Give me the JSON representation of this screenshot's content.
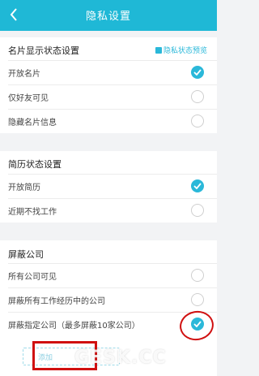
{
  "header": {
    "title": "隐私设置",
    "back_icon": "chevron-left-icon"
  },
  "business_card": {
    "title": "名片显示状态设置",
    "preview_label": "隐私状态预览",
    "options": [
      {
        "label": "开放名片",
        "checked": true
      },
      {
        "label": "仅好友可见",
        "checked": false
      },
      {
        "label": "隐藏名片信息",
        "checked": false
      }
    ]
  },
  "resume": {
    "title": "简历状态设置",
    "options": [
      {
        "label": "开放简历",
        "checked": true
      },
      {
        "label": "近期不找工作",
        "checked": false
      }
    ]
  },
  "block": {
    "title": "屏蔽公司",
    "options": [
      {
        "label": "所有公司可见",
        "checked": false
      },
      {
        "label": "屏蔽所有工作经历中的公司",
        "checked": false
      },
      {
        "label": "屏蔽指定公司（最多屏蔽10家公司）",
        "checked": true
      }
    ],
    "add_label": "添加"
  },
  "watermark": "GESK.CC",
  "colors": {
    "accent": "#2ab8d9",
    "header": "#1fb8d6",
    "annotation": "#d01010"
  }
}
